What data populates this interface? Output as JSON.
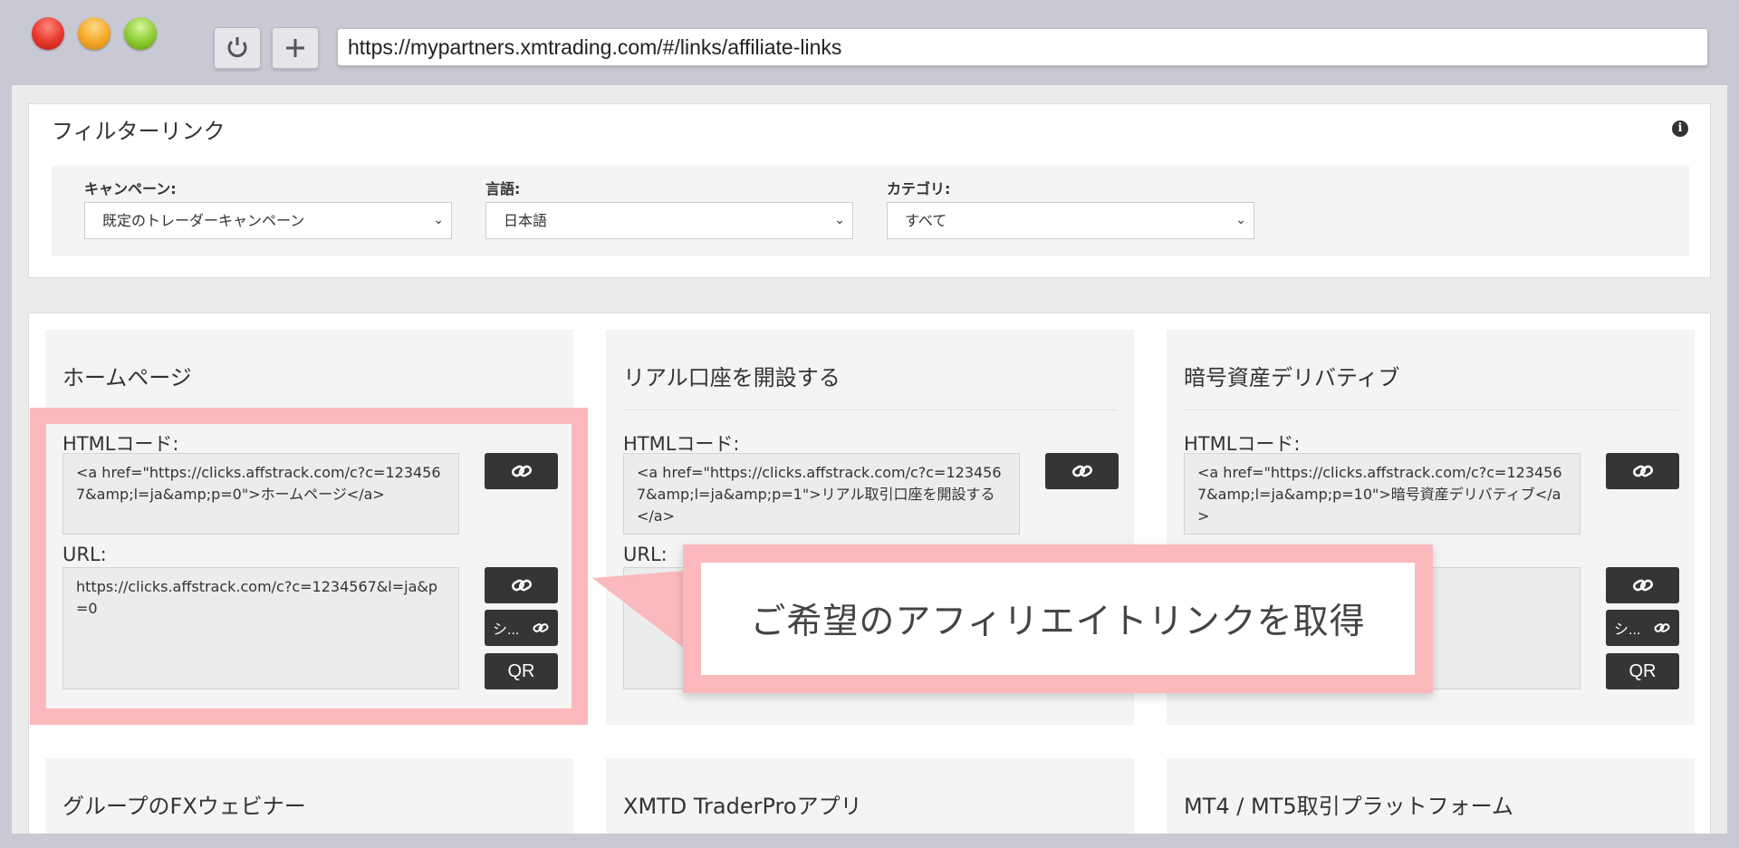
{
  "browser": {
    "url": "https://mypartners.xmtrading.com/#/links/affiliate-links",
    "reload_icon": "reload-icon",
    "new_tab_icon": "plus-icon"
  },
  "filter": {
    "title": "フィルターリンク",
    "info_icon": "info-icon",
    "fields": [
      {
        "label": "キャンペーン:",
        "value": "既定のトレーダーキャンペーン"
      },
      {
        "label": "言語:",
        "value": "日本語"
      },
      {
        "label": "カテゴリ:",
        "value": "すべて"
      }
    ]
  },
  "cards": [
    {
      "title": "ホームページ",
      "html_label": "HTMLコード:",
      "html_code": "<a href=\"https://clicks.affstrack.com/c?c=1234567&amp;l=ja&amp;p=0\">ホームページ</a>",
      "url_label": "URL:",
      "url_value": "https://clicks.affstrack.com/c?c=1234567&l=ja&p=0",
      "short_label": "シ...",
      "qr_label": "QR"
    },
    {
      "title": "リアル口座を開設する",
      "html_label": "HTMLコード:",
      "html_code": "<a href=\"https://clicks.affstrack.com/c?c=1234567&amp;l=ja&amp;p=1\">リアル取引口座を開設する</a>",
      "url_label": "URL:"
    },
    {
      "title": "暗号資産デリバティブ",
      "html_label": "HTMLコード:",
      "html_code": "<a href=\"https://clicks.affstrack.com/c?c=1234567&amp;l=ja&amp;p=10\">暗号資産デリバティブ</a>",
      "short_label": "シ...",
      "qr_label": "QR"
    },
    {
      "title": "グループのFXウェビナー"
    },
    {
      "title": "XMTD TraderProアプリ"
    },
    {
      "title": "MT4 / MT5取引プラットフォーム"
    }
  ],
  "callout": {
    "text": "ご希望のアフィリエイトリンクを取得"
  },
  "colors": {
    "highlight": "#fbb9bd",
    "button": "#353535",
    "card_bg": "#f4f4f4"
  }
}
